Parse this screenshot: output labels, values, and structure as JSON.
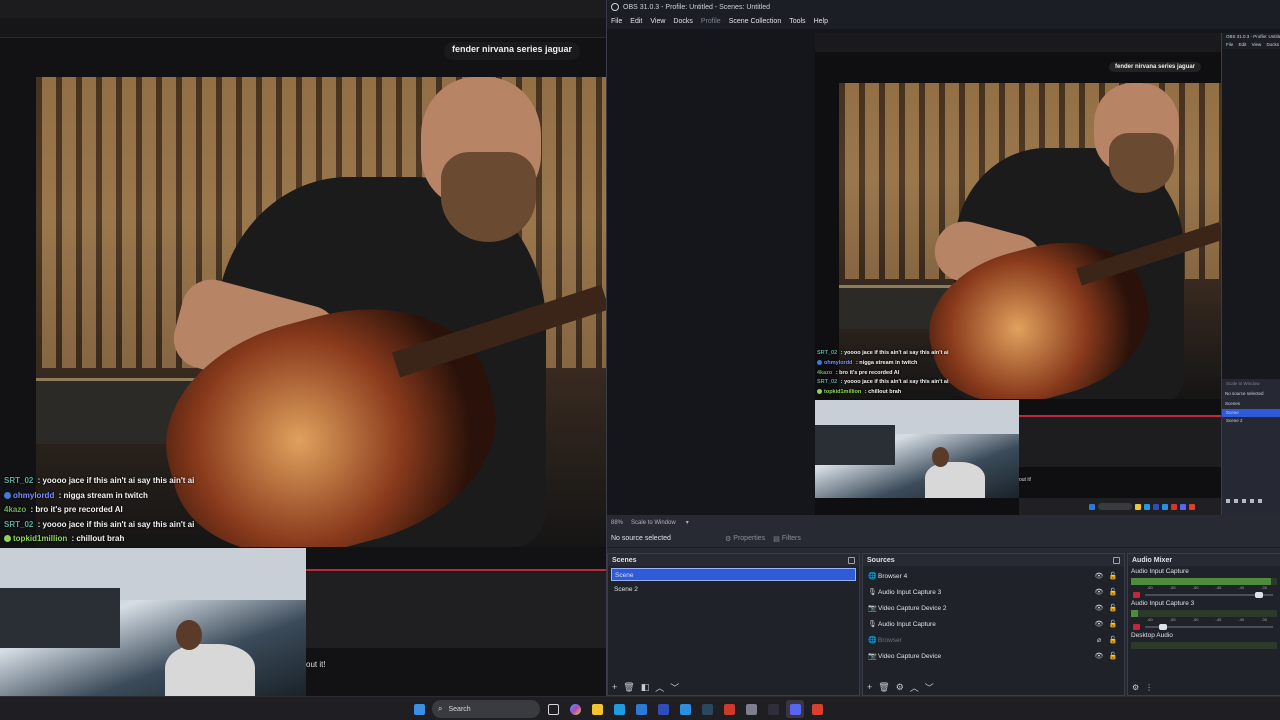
{
  "stream": {
    "search_caption": "fender nirvana series jaguar",
    "chat": [
      {
        "user": "SRT_02",
        "user_color": "#5aaa9a",
        "badge": "",
        "message": " : yoooo jace if this ain't ai say this ain't ai"
      },
      {
        "user": "ohmylordd",
        "user_color": "#7a8cff",
        "badge": "#3e7bd6",
        "message": " : nigga stream in twitch"
      },
      {
        "user": "4kazo",
        "user_color": "#6ab04c",
        "badge": "",
        "message": " : bro it's pre recorded AI"
      },
      {
        "user": "SRT_02",
        "user_color": "#5aaa9a",
        "badge": "",
        "message": " : yoooo jace if this ain't ai say this ain't ai"
      },
      {
        "user": "topkid1million",
        "user_color": "#8bd65a",
        "badge": "#8bd65a",
        "message": " : chillout brah"
      }
    ],
    "side_text": "out it!"
  },
  "obs": {
    "title": "OBS 31.0.3 - Profile: Untitled - Scenes: Untitled",
    "menu": [
      {
        "label": "File",
        "enabled": true
      },
      {
        "label": "Edit",
        "enabled": true
      },
      {
        "label": "View",
        "enabled": true
      },
      {
        "label": "Docks",
        "enabled": true
      },
      {
        "label": "Profile",
        "enabled": false
      },
      {
        "label": "Scene Collection",
        "enabled": true
      },
      {
        "label": "Tools",
        "enabled": true
      },
      {
        "label": "Help",
        "enabled": true
      }
    ],
    "zoom_value": "88%",
    "zoom_mode": "Scale to Window",
    "no_source": "No source selected",
    "properties_label": "Properties",
    "filters_label": "Filters",
    "scenes": {
      "title": "Scenes",
      "items": [
        "Scene",
        "Scene 2"
      ],
      "selected": 0
    },
    "sources": {
      "title": "Sources",
      "items": [
        {
          "name": "Browser 4",
          "icon": "globe-icon",
          "visible": true
        },
        {
          "name": "Audio Input Capture 3",
          "icon": "mic-icon",
          "visible": true
        },
        {
          "name": "Video Capture Device 2",
          "icon": "camera-icon",
          "visible": true
        },
        {
          "name": "Audio Input Capture",
          "icon": "mic-icon",
          "visible": true
        },
        {
          "name": "Browser",
          "icon": "globe-icon",
          "visible": false
        },
        {
          "name": "Video Capture Device",
          "icon": "camera-icon",
          "visible": true
        }
      ]
    },
    "mixer": {
      "title": "Audio Mixer",
      "channels": [
        {
          "name": "Audio Input Capture",
          "level": 0.96,
          "fader": 0.92
        },
        {
          "name": "Audio Input Capture 3",
          "level": 0.05,
          "fader": 0.12
        },
        {
          "name": "Desktop Audio",
          "level": 0.0,
          "fader": 0.95
        }
      ],
      "ticks": [
        "-60",
        "-55",
        "-50",
        "-45",
        "-40",
        "-35"
      ]
    }
  },
  "nested_obs": {
    "title": "OBS 31.0.3 - Profile: Untitled",
    "menu": [
      "File",
      "Edit",
      "View",
      "Docks"
    ],
    "zoom_mode": "Scale to Window",
    "no_source": "No source selected",
    "scenes_title": "Scenes",
    "scenes": [
      "Scene",
      "Scene 2"
    ]
  },
  "canvas": {
    "search_caption": "fender nirvana series jaguar",
    "search_label": "Search",
    "side_text": "out it!"
  },
  "taskbar": {
    "search_label": "Search",
    "apps": [
      {
        "name": "file-explorer-icon",
        "color": "#f4c430"
      },
      {
        "name": "edge-icon",
        "color": "#1f9be0"
      },
      {
        "name": "store-icon",
        "color": "#2b7bd6"
      },
      {
        "name": "l-app-icon",
        "color": "#2e4dbb"
      },
      {
        "name": "vscode-icon",
        "color": "#2a8fe0"
      },
      {
        "name": "steam-icon",
        "color": "#2a475e"
      },
      {
        "name": "media-player-icon",
        "color": "#d03a2a"
      },
      {
        "name": "settings-icon",
        "color": "#7d808c"
      },
      {
        "name": "obs-icon",
        "color": "#302e3a"
      },
      {
        "name": "discord-icon",
        "color": "#5865f2"
      },
      {
        "name": "chrome-icon",
        "color": "#d9402e"
      }
    ]
  }
}
